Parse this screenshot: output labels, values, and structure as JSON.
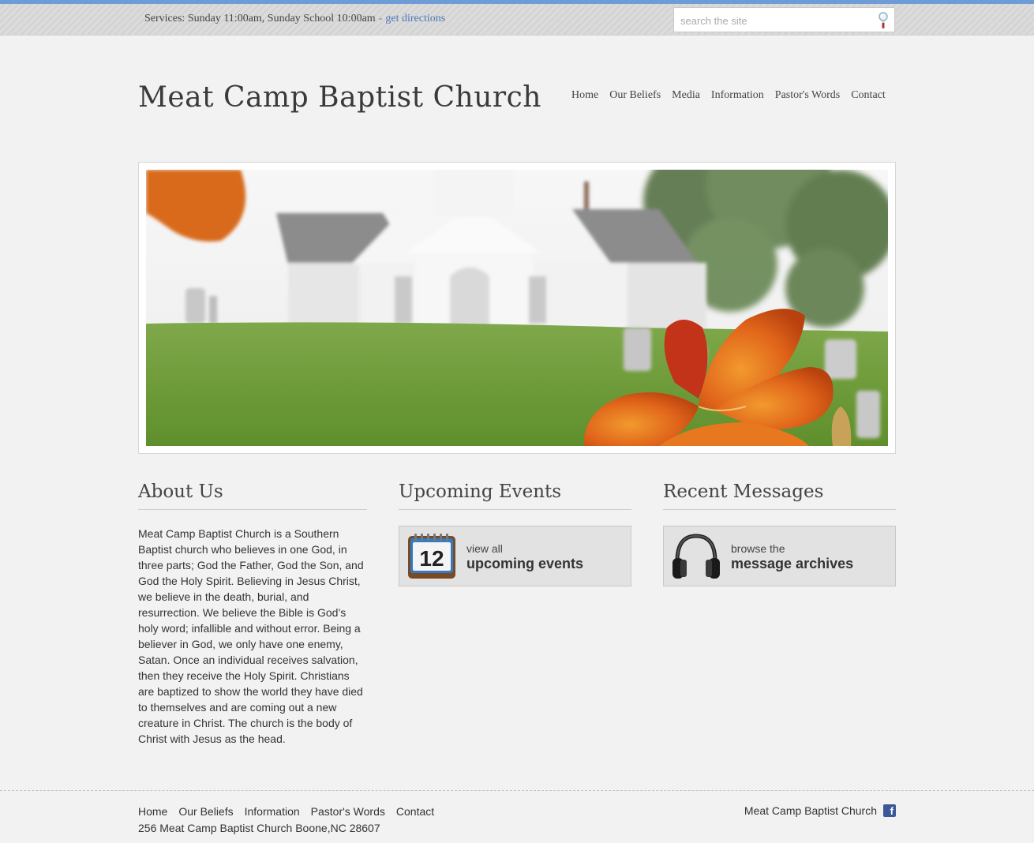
{
  "topbar": {
    "services_text": "Services: Sunday 11:00am, Sunday School 10:00am",
    "separator": "-",
    "directions_link": "get directions",
    "search_placeholder": "search the site",
    "search_icon": "magnifier-icon"
  },
  "header": {
    "site_title": "Meat Camp Baptist Church",
    "nav": [
      "Home",
      "Our Beliefs",
      "Media",
      "Information",
      "Pastor's Words",
      "Contact"
    ]
  },
  "hero": {
    "image": "church-with-orange-lily-photo"
  },
  "about": {
    "heading": "About Us",
    "body": "Meat Camp Baptist Church is a Southern Baptist church who believes in one God, in three parts; God the Father, God the Son, and God the Holy Spirit. Believing in Jesus Christ, we believe in the death, burial, and resurrection. We believe the Bible is God’s holy word; infallible and without error. Being a believer in God, we only have one enemy, Satan. Once an individual receives salvation, then they receive the Holy Spirit. Christians are baptized to show the world they have died to themselves and are coming out a new creature in Christ. The church is the body of Christ with Jesus as the head."
  },
  "events": {
    "heading": "Upcoming Events",
    "cta_small": "view all",
    "cta_big": "upcoming events",
    "calendar_number": "12",
    "icon": "calendar-icon"
  },
  "messages": {
    "heading": "Recent Messages",
    "cta_small": "browse the",
    "cta_big": "message archives",
    "icon": "headphones-icon"
  },
  "footer": {
    "nav": [
      "Home",
      "Our Beliefs",
      "Information",
      "Pastor's Words",
      "Contact"
    ],
    "address": "256 Meat Camp Baptist Church Boone,NC 28607",
    "right_text": "Meat Camp Baptist Church",
    "social_icon": "facebook-icon",
    "facebook_glyph": "f"
  },
  "colors": {
    "accent": "#6f9bd6",
    "link": "#4f78b6",
    "facebook": "#3b5998"
  }
}
